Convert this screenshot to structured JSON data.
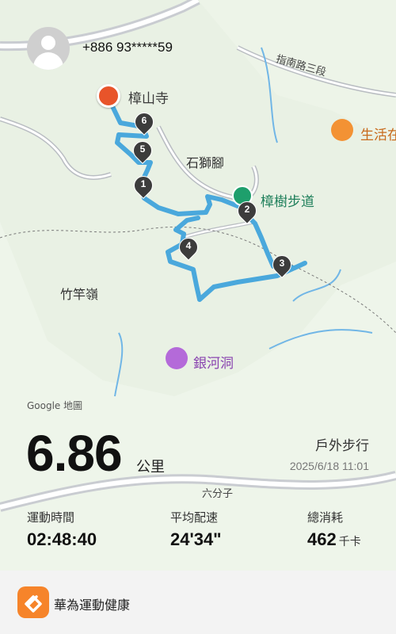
{
  "header": {
    "phone": "+886 93*****59"
  },
  "map": {
    "road_labels": [
      "指南路三段",
      "六分子"
    ],
    "poi": {
      "start": "樟山寺",
      "trail": "樟樹步道",
      "cafe": "生活在",
      "cave": "銀河洞",
      "place1": "石獅腳",
      "place2": "竹竿嶺"
    },
    "markers": [
      "1",
      "2",
      "3",
      "4",
      "5",
      "6"
    ],
    "attribution": "Google 地圖"
  },
  "activity": {
    "distance": "6.86",
    "distance_unit": "公里",
    "type": "戶外步行",
    "datetime": "2025/6/18 11:01",
    "metrics": [
      {
        "label": "運動時間",
        "value": "02:48:40",
        "unit": ""
      },
      {
        "label": "平均配速",
        "value": "24'34\"",
        "unit": ""
      },
      {
        "label": "總消耗",
        "value": "462",
        "unit": "千卡"
      }
    ]
  },
  "footer": {
    "app_name": "華為運動健康"
  },
  "colors": {
    "route": "#4aa8dc",
    "map_bg": "#e9f1e4",
    "start_flag": "#e8542a",
    "trail_icon": "#1e9f6c",
    "cafe_icon": "#f39234",
    "cave_icon": "#b46ad9",
    "app_logo": "#f6842a"
  }
}
